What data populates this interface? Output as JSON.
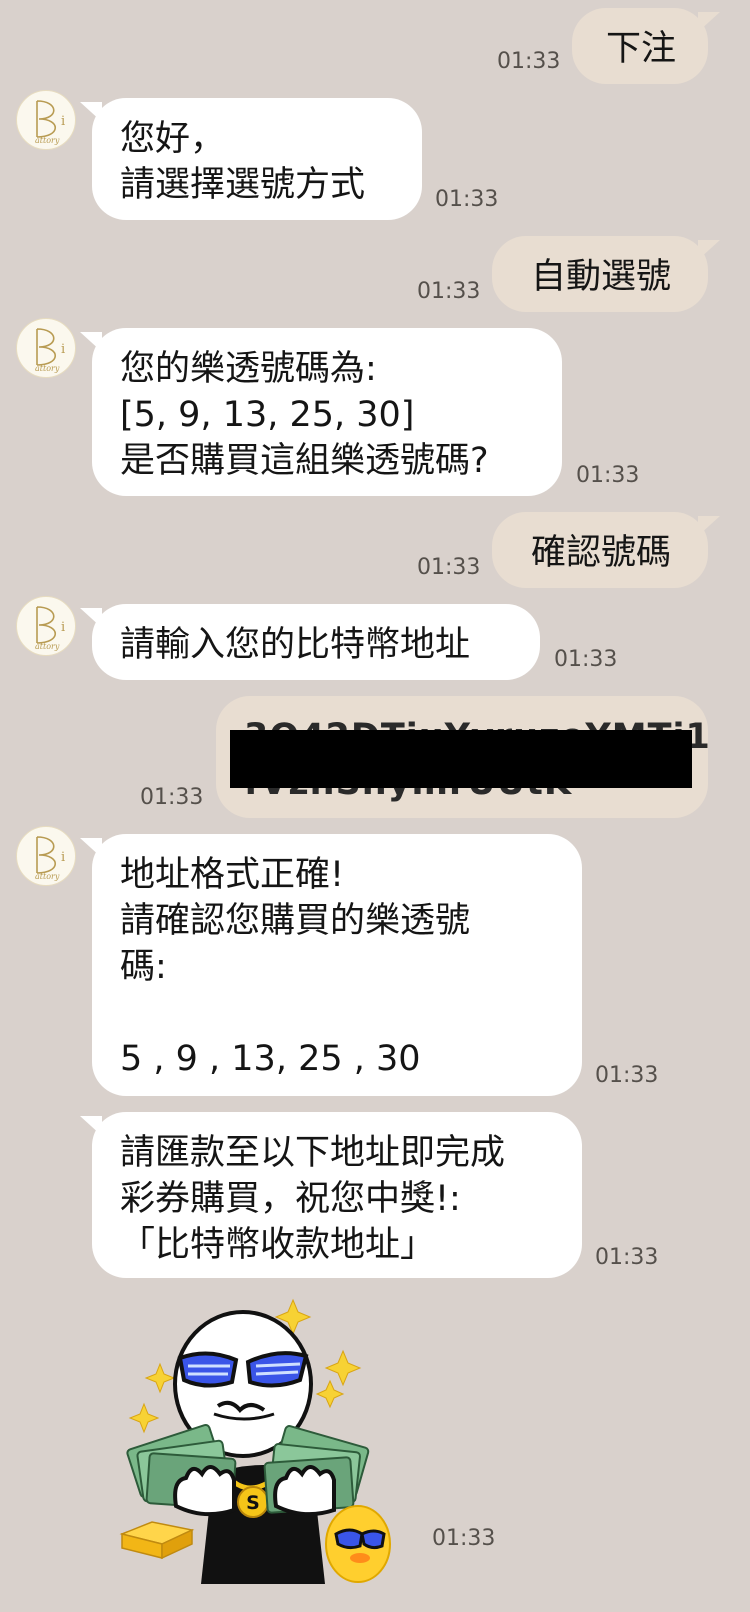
{
  "bot": {
    "avatar_initial": "B",
    "avatar_letter": "i",
    "avatar_script": "attory"
  },
  "messages": {
    "m1": {
      "text": "下注",
      "time": "01:33"
    },
    "m2": {
      "line1": "您好，",
      "line2": "請選擇選號方式",
      "time": "01:33"
    },
    "m3": {
      "text": "自動選號",
      "time": "01:33"
    },
    "m4": {
      "line1": "您的樂透號碼為:",
      "line2": "[5, 9, 13, 25, 30]",
      "line3": "是否購買這組樂透號碼?",
      "time": "01:33"
    },
    "m5": {
      "text": "確認號碼",
      "time": "01:33"
    },
    "m6": {
      "text": "請輸入您的比特幣地址",
      "time": "01:33"
    },
    "m7": {
      "line1": "3Q42DTiuYvruzoYMTi1V",
      "line2": "fVzhSnymrUUtK",
      "time": "01:33"
    },
    "m8": {
      "line1": "地址格式正確!",
      "line2": "請確認您購買的樂透號",
      "line3": "碼:",
      "line4": "5 , 9 , 13, 25 , 30",
      "time": "01:33"
    },
    "m9": {
      "line1": "請匯款至以下地址即完成",
      "line2": "彩券購買，祝您中獎!:",
      "line3": "「比特幣收款地址」",
      "time": "01:33"
    },
    "m10": {
      "sticker_badge": "S",
      "time": "01:33"
    }
  }
}
